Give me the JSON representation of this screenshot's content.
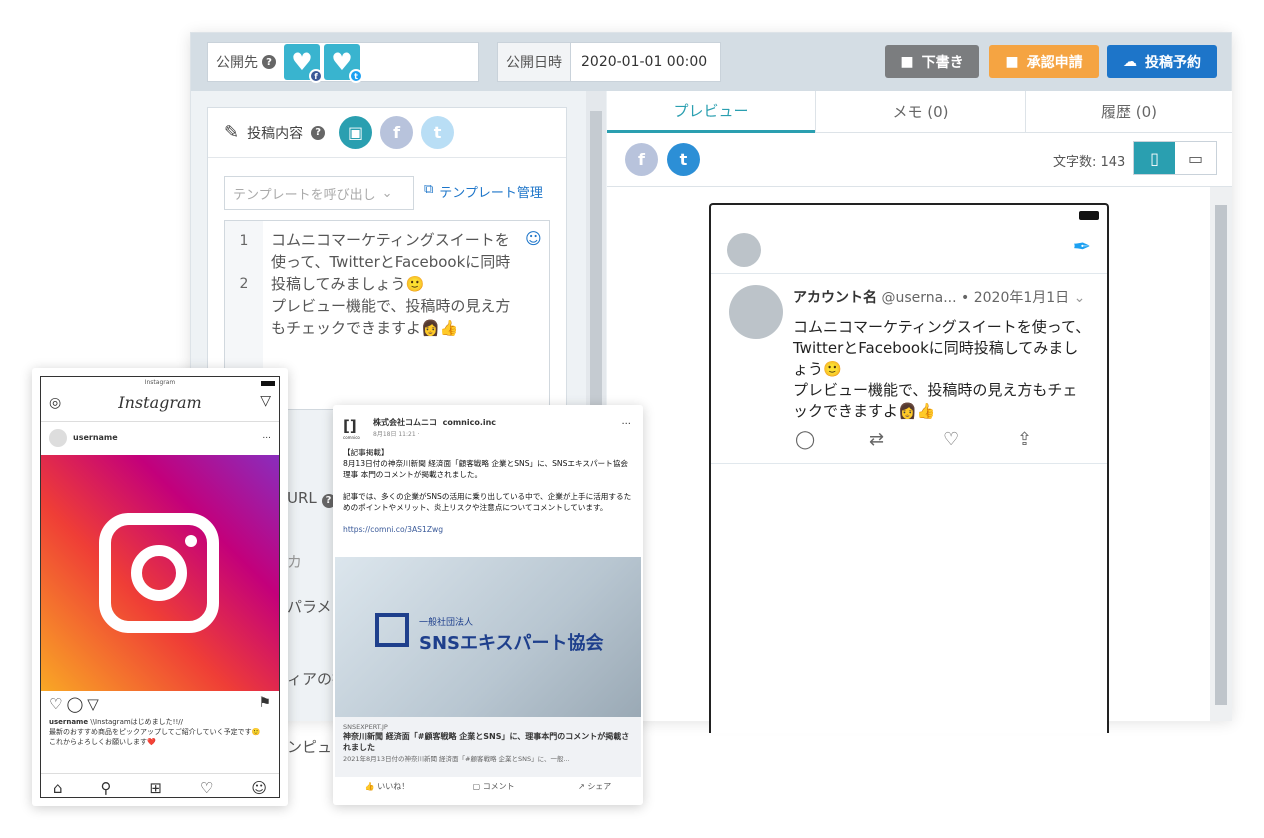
{
  "topbar": {
    "publish_to_label": "公開先",
    "publish_date_label": "公開日時",
    "publish_date_value": "2020-01-01 00:00",
    "draft_label": "下書き",
    "approval_label": "承認申請",
    "schedule_label": "投稿予約",
    "colors": {
      "draft": "#7b7d7f",
      "approval": "#f5a442",
      "schedule": "#1d75c9"
    }
  },
  "editor": {
    "post_content_label": "投稿内容",
    "template_placeholder": "テンプレートを呼び出し",
    "template_manage": "テンプレート管理",
    "line1": "1",
    "line2": "2",
    "text1": "コムニコマーケティングスイートを使って、TwitterとFacebookに同時投稿してみましょう",
    "text2": "プレビュー機能で、投稿時の見え方もチェックできますよ",
    "hidden_labels": [
      "URL",
      "カ",
      "パラメー",
      "ィアの投",
      "ンピュー"
    ]
  },
  "preview": {
    "tabs": [
      "プレビュー",
      "メモ (0)",
      "履歴 (0)"
    ],
    "char_count_label": "文字数: 143"
  },
  "tweet": {
    "account": "アカウント名",
    "handle": "@userna...",
    "dot": "•",
    "date": "2020年1月1日",
    "text": "コムニコマーケティングスイートを使って、TwitterとFacebookに同時投稿してみましょう",
    "text2": "プレビュー機能で、投稿時の見え方もチェックできますよ"
  },
  "instagram": {
    "status_title": "Instagram",
    "app_title": "Instagram",
    "username": "username",
    "caption_user": "username",
    "caption_text": "\\\\Instagramはじめました!!//",
    "caption_line2": "最新のおすすめ商品をピックアップしてご紹介していく予定です",
    "caption_line3": "これからよろしくお願いします",
    "more_dots": "…",
    "menu_dots": "..."
  },
  "facebook": {
    "page_name": "株式会社コムニコ",
    "handle": "comnico.inc",
    "date": "8月18日 11:21 ·",
    "dots": "···",
    "logo_sub": "comnico",
    "body1": "【記事掲載】",
    "body2": "8月13日付の神奈川新聞 経済面「顧客戦略 企業とSNS」に、SNSエキスパート協会理事 本門のコメントが掲載されました。",
    "body3": "記事では、多くの企業がSNSの活用に乗り出している中で、企業が上手に活用するためのポイントやメリット、炎上リスクや注意点についてコメントしています。",
    "link": "https://comni.co/3AS1Zwg",
    "banner_small": "一般社団法人",
    "banner_big": "SNSエキスパート協会",
    "site": "SNSEXPERT.JP",
    "headline": "神奈川新聞 経済面「#顧客戦略 企業とSNS」に、理事本門のコメントが掲載されました",
    "snippet": "2021年8月13日付の神奈川新聞 経済面「#顧客戦略 企業とSNS」に、一般...",
    "like": "いいね！",
    "comment": "コメント",
    "share": "シェア"
  }
}
